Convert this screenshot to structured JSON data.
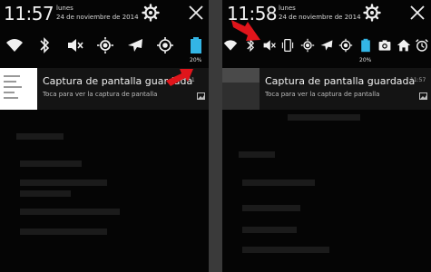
{
  "left": {
    "time": "11:57",
    "day": "lunes",
    "date": "24 de noviembre de 2014",
    "battery_label": "20%",
    "notification": {
      "title": "Captura de pantalla guardada",
      "subtitle": "Toca para ver la captura de pantalla",
      "time": "11"
    }
  },
  "right": {
    "time": "11:58",
    "day": "lunes",
    "date": "24 de noviembre de 2014",
    "battery_label": "20%",
    "notification": {
      "title": "Captura de pantalla guardada",
      "subtitle": "Toca para ver la captura de pantalla",
      "time": "11:57"
    }
  },
  "colors": {
    "accent": "#33b5e5",
    "arrow": "#e0151b",
    "text": "#f2f2f2"
  },
  "icons": {
    "header": [
      "settings-icon",
      "close-icon"
    ],
    "left_quick_settings": [
      "wifi-icon",
      "bluetooth-icon",
      "mute-icon",
      "brightness-icon",
      "airplane-icon",
      "location-icon",
      "battery-icon"
    ],
    "right_quick_settings": [
      "wifi-icon",
      "bluetooth-icon",
      "mute-icon",
      "vibrate-icon",
      "brightness-icon",
      "airplane-icon",
      "location-icon",
      "battery-icon",
      "camera-icon",
      "home-icon",
      "alarm-icon"
    ]
  }
}
